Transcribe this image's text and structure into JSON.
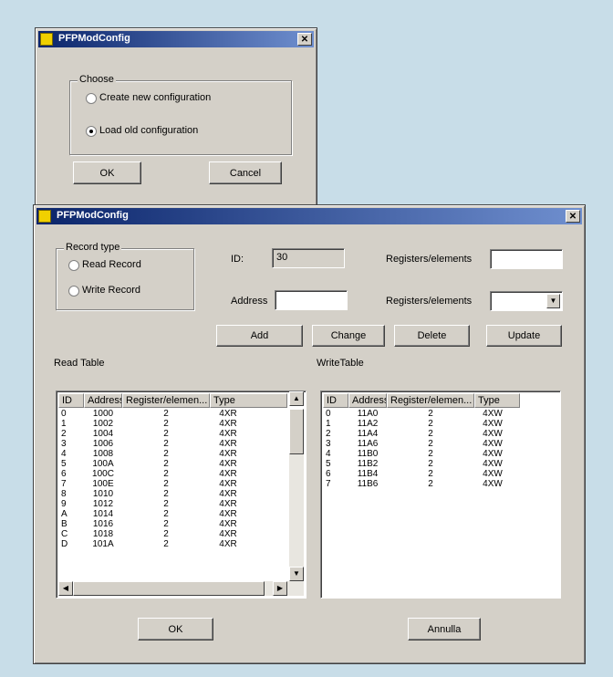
{
  "dialog1": {
    "title": "PFPModConfig",
    "choose_label": "Choose",
    "option_new": "Create new configuration",
    "option_old": "Load old configuration",
    "selected": "old",
    "ok_label": "OK",
    "cancel_label": "Cancel"
  },
  "dialog2": {
    "title": "PFPModConfig",
    "record_type_label": "Record type",
    "read_record": "Read Record",
    "write_record": "Write Record",
    "id_label": "ID:",
    "id_value": "30",
    "address_label": "Address",
    "address_value": "",
    "reg1_label": "Registers/elements",
    "reg1_value": "",
    "reg2_label": "Registers/elements",
    "reg2_value": "",
    "buttons": {
      "add": "Add",
      "change": "Change",
      "delete": "Delete",
      "update": "Update"
    },
    "read_table_label": "Read Table",
    "write_table_label": "WriteTable",
    "ok_label": "OK",
    "cancel_label": "Annulla"
  },
  "read_table": {
    "columns": [
      "ID",
      "Address",
      "Register/elemen...",
      "Type"
    ],
    "rows": [
      [
        "0",
        "1000",
        "2",
        "4XR"
      ],
      [
        "1",
        "1002",
        "2",
        "4XR"
      ],
      [
        "2",
        "1004",
        "2",
        "4XR"
      ],
      [
        "3",
        "1006",
        "2",
        "4XR"
      ],
      [
        "4",
        "1008",
        "2",
        "4XR"
      ],
      [
        "5",
        "100A",
        "2",
        "4XR"
      ],
      [
        "6",
        "100C",
        "2",
        "4XR"
      ],
      [
        "7",
        "100E",
        "2",
        "4XR"
      ],
      [
        "8",
        "1010",
        "2",
        "4XR"
      ],
      [
        "9",
        "1012",
        "2",
        "4XR"
      ],
      [
        "A",
        "1014",
        "2",
        "4XR"
      ],
      [
        "B",
        "1016",
        "2",
        "4XR"
      ],
      [
        "C",
        "1018",
        "2",
        "4XR"
      ],
      [
        "D",
        "101A",
        "2",
        "4XR"
      ]
    ]
  },
  "write_table": {
    "columns": [
      "ID",
      "Address",
      "Register/elemen...",
      "Type"
    ],
    "rows": [
      [
        "0",
        "11A0",
        "2",
        "4XW"
      ],
      [
        "1",
        "11A2",
        "2",
        "4XW"
      ],
      [
        "2",
        "11A4",
        "2",
        "4XW"
      ],
      [
        "3",
        "11A6",
        "2",
        "4XW"
      ],
      [
        "4",
        "11B0",
        "2",
        "4XW"
      ],
      [
        "5",
        "11B2",
        "2",
        "4XW"
      ],
      [
        "6",
        "11B4",
        "2",
        "4XW"
      ],
      [
        "7",
        "11B6",
        "2",
        "4XW"
      ]
    ]
  }
}
